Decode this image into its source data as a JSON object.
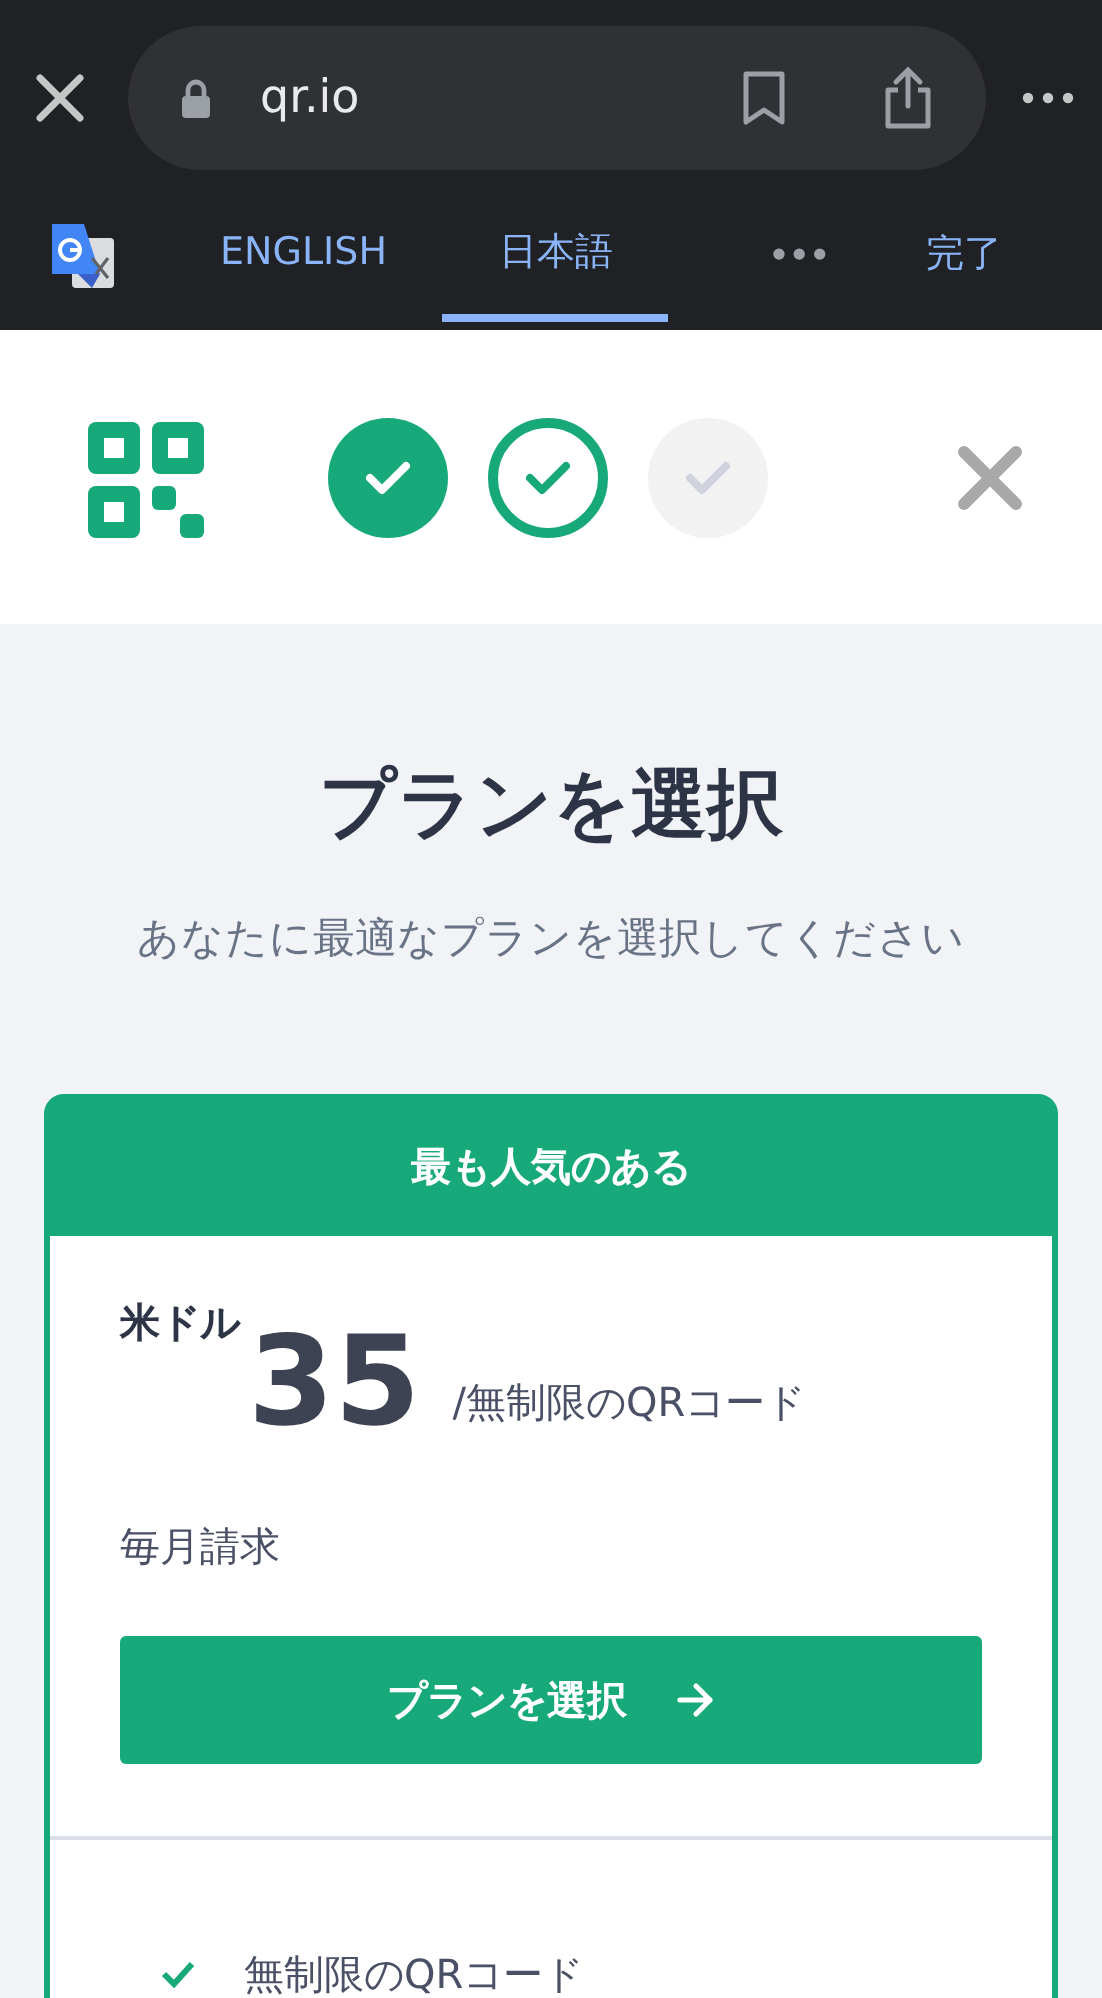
{
  "browser": {
    "url": "qr.io"
  },
  "translate_bar": {
    "languages": [
      {
        "label": "ENGLISH",
        "selected": false
      },
      {
        "label": "日本語",
        "selected": true
      }
    ],
    "more": "•••",
    "done": "完了"
  },
  "steps": [
    {
      "kind": "done"
    },
    {
      "kind": "current"
    },
    {
      "kind": "pending"
    }
  ],
  "title": "プランを選択",
  "subtitle": "あなたに最適なプランを選択してください",
  "plan": {
    "ribbon": "最も人気のある",
    "currency": "米ドル",
    "price": "35",
    "per": "/無制限のQRコード",
    "billing": "毎月請求",
    "button": "プランを選択",
    "features": [
      "無制限のQRコード"
    ]
  }
}
